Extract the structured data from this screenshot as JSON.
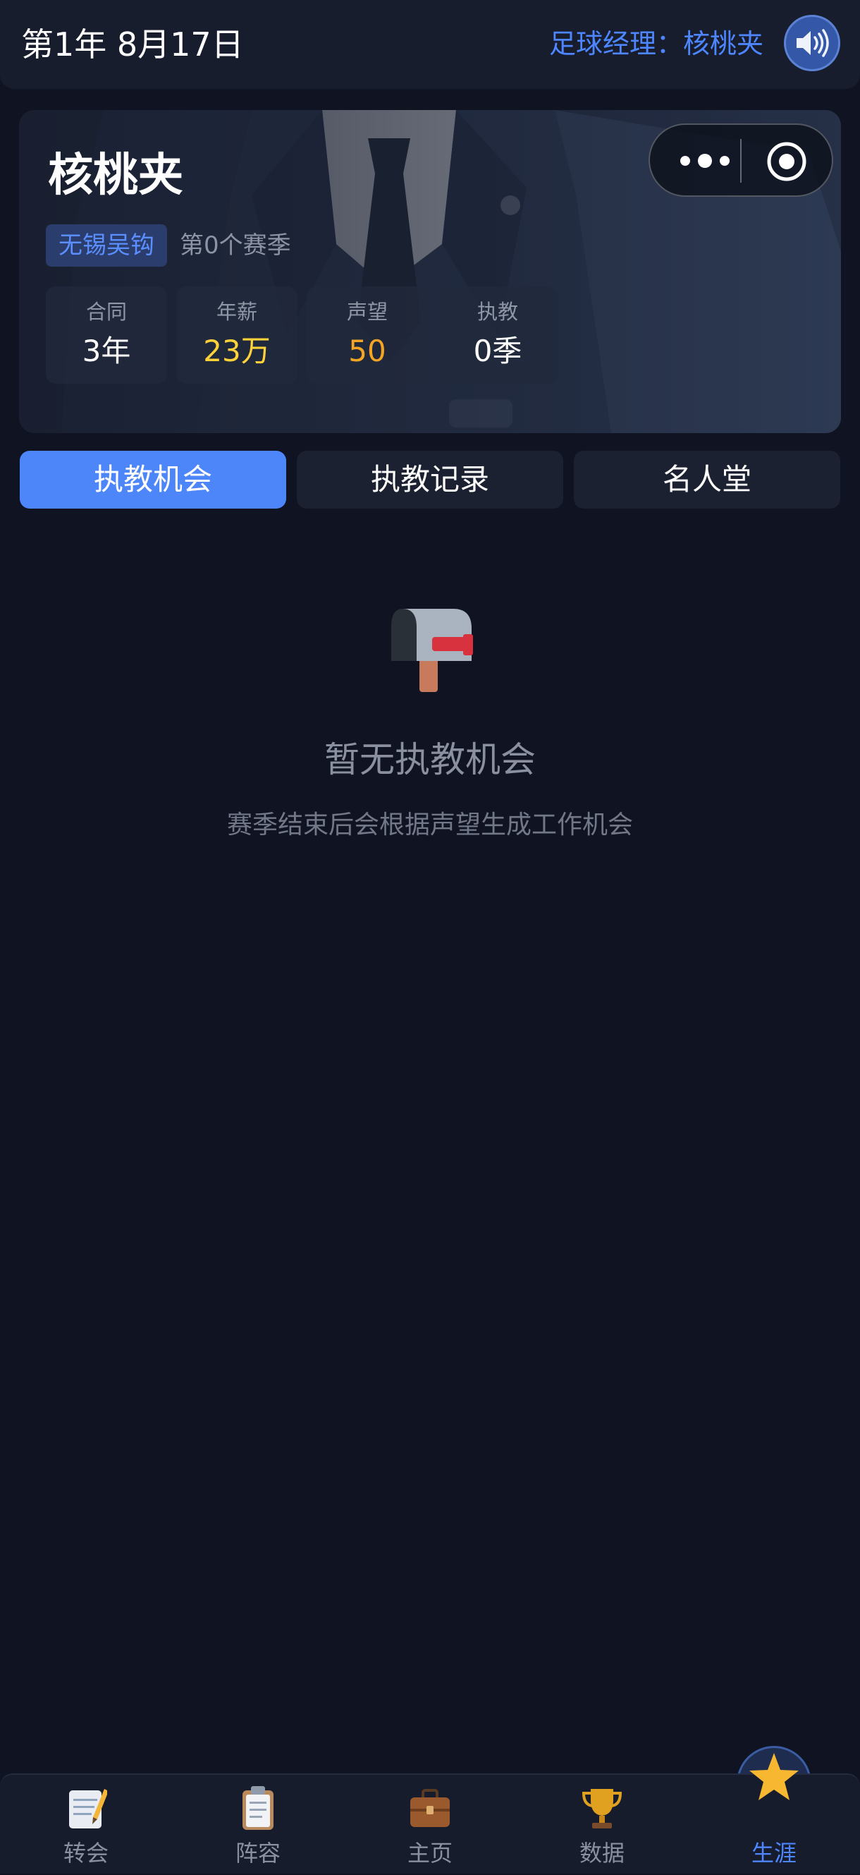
{
  "header": {
    "date": "第1年 8月17日",
    "manager_label": "足球经理：核桃夹",
    "sound_icon": "speaker-icon"
  },
  "profile": {
    "name": "核桃夹",
    "club": "无锡吴钩",
    "season": "第0个赛季",
    "stats": [
      {
        "label": "合同",
        "value": "3年",
        "color": "#ffffff"
      },
      {
        "label": "年薪",
        "value": "23万",
        "color": "#ffd23a"
      },
      {
        "label": "声望",
        "value": "50",
        "color": "#f5a524"
      },
      {
        "label": "执教",
        "value": "0季",
        "color": "#ffffff"
      }
    ]
  },
  "capsule": {
    "more_icon": "more-dots-icon",
    "close_icon": "target-circle-icon"
  },
  "tabs": [
    {
      "label": "执教机会",
      "active": true
    },
    {
      "label": "执教记录",
      "active": false
    },
    {
      "label": "名人堂",
      "active": false
    }
  ],
  "empty_state": {
    "icon": "mailbox-icon",
    "title": "暂无执教机会",
    "subtitle": "赛季结束后会根据声望生成工作机会"
  },
  "bottom_nav": [
    {
      "label": "转会",
      "icon": "memo-pencil-icon",
      "active": false
    },
    {
      "label": "阵容",
      "icon": "clipboard-icon",
      "active": false
    },
    {
      "label": "主页",
      "icon": "briefcase-icon",
      "active": false
    },
    {
      "label": "数据",
      "icon": "trophy-icon",
      "active": false
    },
    {
      "label": "生涯",
      "icon": "star-icon",
      "active": true
    }
  ],
  "colors": {
    "accent": "#4d86ff",
    "background": "#0f1322",
    "salary": "#ffd23a",
    "reputation": "#f5a524"
  }
}
